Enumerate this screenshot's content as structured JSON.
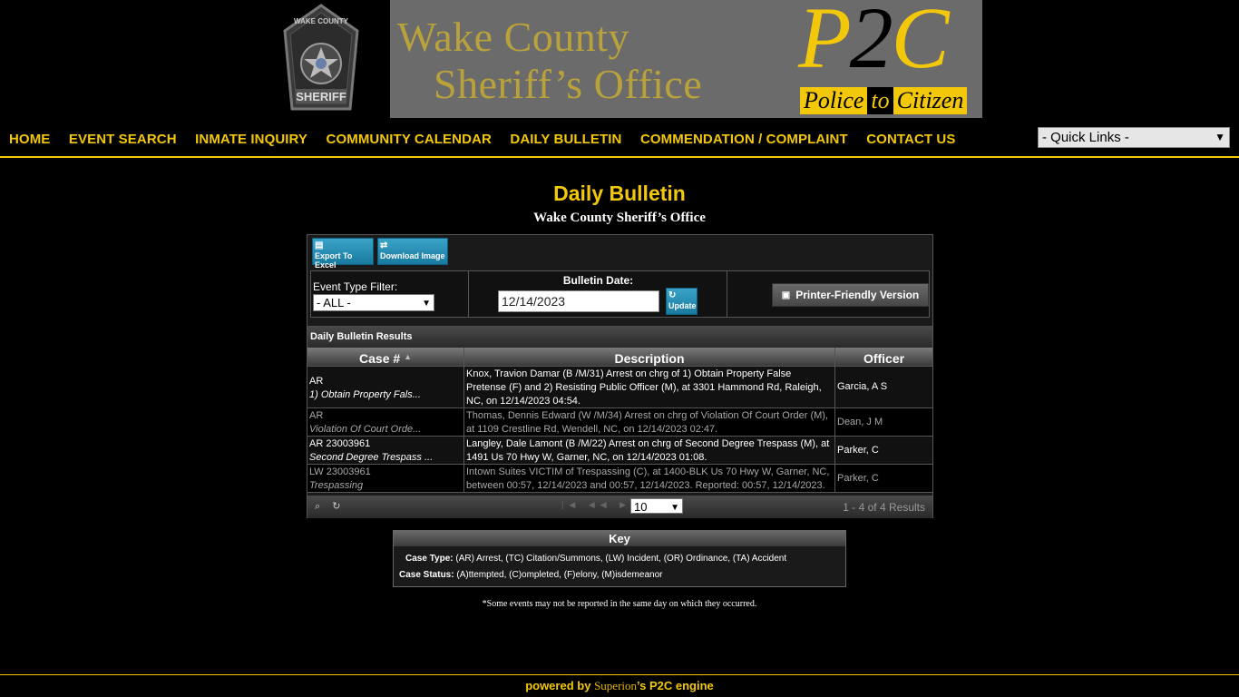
{
  "header": {
    "badge_top": "WAKE COUNTY",
    "badge_bottom": "SHERIFF",
    "banner_line1": "Wake County",
    "banner_line2": "Sheriff’s Office",
    "p2c_p": "P",
    "p2c_2": "2",
    "p2c_c": "C",
    "ptc_police": "Police",
    "ptc_to": "to",
    "ptc_citizen": "Citizen"
  },
  "nav": {
    "items": [
      "HOME",
      "EVENT SEARCH",
      "INMATE INQUIRY",
      "COMMUNITY CALENDAR",
      "DAILY BULLETIN",
      "COMMENDATION / COMPLAINT",
      "CONTACT US"
    ],
    "quick_links": "- Quick Links -"
  },
  "page": {
    "title": "Daily Bulletin",
    "subtitle": "Wake County Sheriff’s Office"
  },
  "toolbar": {
    "export_label": "Export To Excel",
    "download_label": "Download Image"
  },
  "filters": {
    "event_type_label": "Event Type Filter:",
    "event_type_value": "- ALL -",
    "bulletin_date_label": "Bulletin Date:",
    "bulletin_date_value": "12/14/2023",
    "update_label": "Update",
    "printer_label": "Printer-Friendly Version"
  },
  "results": {
    "bar_title": "Daily Bulletin Results",
    "columns": [
      "Case #",
      "Description",
      "Officer"
    ],
    "rows": [
      {
        "case_id": "AR",
        "case_type": "1) Obtain Property Fals...",
        "description": "Knox, Travion Damar (B /M/31) Arrest on chrg of 1) Obtain Property False Pretense (F) and 2) Resisting Public Officer (M), at 3301 Hammond Rd, Raleigh, NC, on 12/14/2023 04:54.",
        "officer": "Garcia, A S"
      },
      {
        "case_id": "AR",
        "case_type": "Violation Of Court Orde...",
        "description": "Thomas, Dennis Edward (W /M/34) Arrest on chrg of Violation Of Court Order (M), at 1109 Crestline Rd, Wendell, NC, on 12/14/2023 02:47.",
        "officer": "Dean, J M"
      },
      {
        "case_id": "AR 23003961",
        "case_type": "Second Degree Trespass ...",
        "description": "Langley, Dale Lamont (B /M/22) Arrest on chrg of Second Degree Trespass (M), at 1491 Us 70 Hwy W, Garner, NC, on 12/14/2023 01:08.",
        "officer": "Parker, C"
      },
      {
        "case_id": "LW 23003961",
        "case_type": "Trespassing",
        "description": "Intown Suites VICTIM of Trespassing (C), at 1400-BLK Us 70 Hwy W, Garner, NC, between 00:57, 12/14/2023 and 00:57, 12/14/2023. Reported: 00:57, 12/14/2023.",
        "officer": "Parker, C"
      }
    ],
    "page_size": "10",
    "summary": "1 - 4 of 4 Results"
  },
  "key": {
    "title": "Key",
    "case_type_label": "Case Type:",
    "case_type_text": "(AR) Arrest, (TC) Citation/Summons, (LW) Incident, (OR) Ordinance, (TA) Accident",
    "case_status_label": "Case Status:",
    "case_status_text": "(A)ttempted, (C)ompleted, (F)elony, (M)isdemeanor"
  },
  "note": "*Some events may not be reported in the same day on which they occurred.",
  "footer": {
    "prefix": "powered by",
    "brand": "Superion",
    "suffix": "’s P2C engine"
  },
  "colors": {
    "accent": "#f3c80a",
    "background": "#000000",
    "button_blue": "#1a7aa0"
  }
}
